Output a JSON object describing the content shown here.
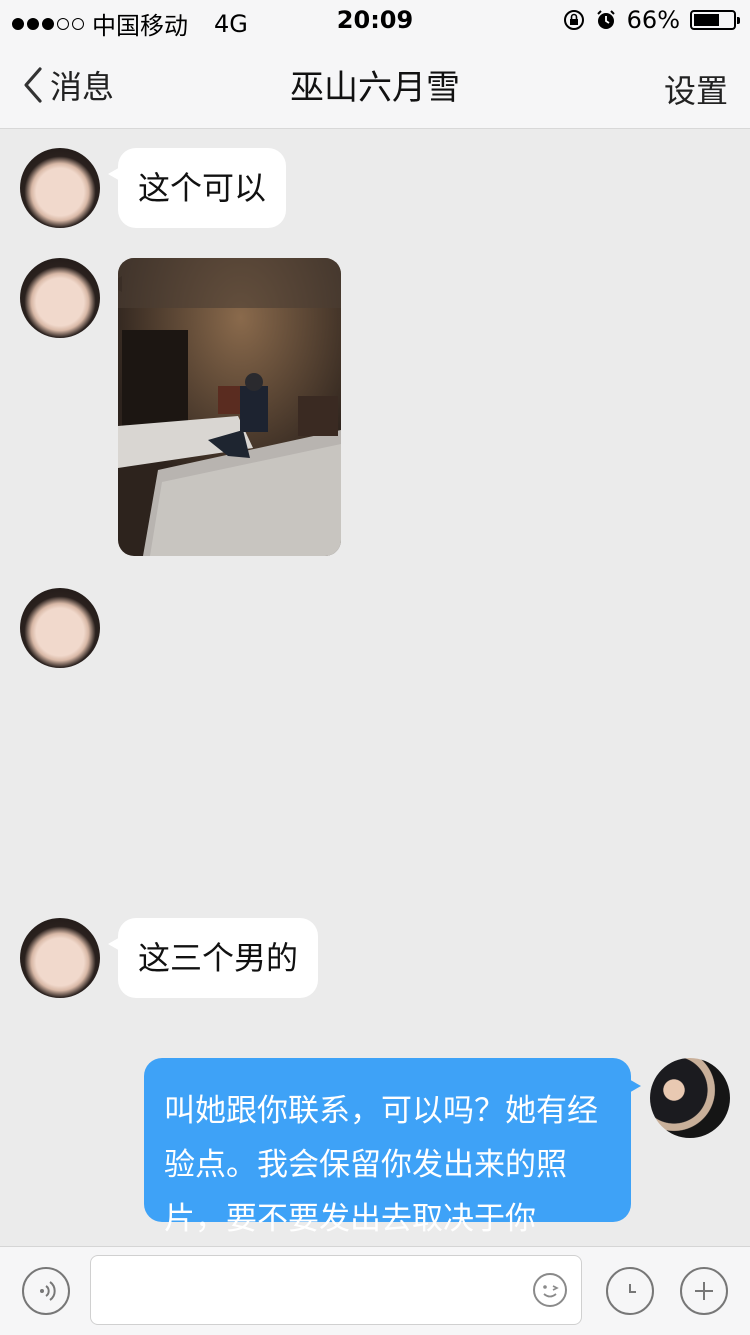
{
  "status_bar": {
    "carrier": "中国移动",
    "network": "4G",
    "time": "20:09",
    "battery_percent": "66%",
    "battery_level": 0.66
  },
  "nav": {
    "back_label": "消息",
    "title": "巫山六月雪",
    "settings_label": "设置"
  },
  "messages": [
    {
      "side": "left",
      "text": "这个可以"
    },
    {
      "side": "left",
      "type": "image"
    },
    {
      "side": "left",
      "type": "empty"
    },
    {
      "side": "left",
      "text": "这三个男的"
    },
    {
      "side": "right",
      "text": "叫她跟你联系，可以吗？她有经验点。我会保留你发出来的照片，要不要发出去取决于你"
    }
  ],
  "icons": {
    "back": "chevron-left-icon",
    "voice": "voice-icon",
    "emoji": "emoji-icon",
    "clock": "clock-icon",
    "add": "plus-icon",
    "lock": "orientation-lock-icon",
    "alarm": "alarm-icon"
  },
  "colors": {
    "outgoing_bubble": "#3ea2f7",
    "incoming_bubble": "#ffffff",
    "chat_background": "#ebebeb"
  }
}
